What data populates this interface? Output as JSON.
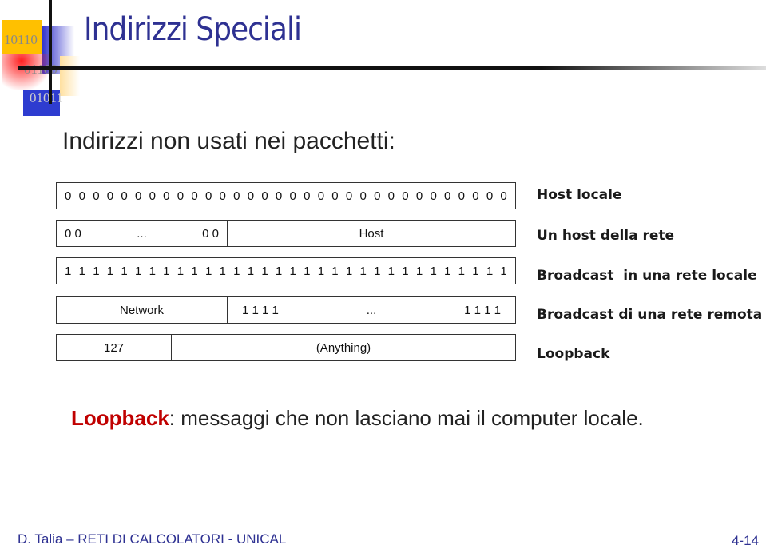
{
  "header": {
    "title": "Indirizzi Speciali",
    "logo_text": [
      "10110",
      "01100",
      "01011"
    ]
  },
  "subtitle": "Indirizzi non usati nei pacchetti:",
  "rows": [
    {
      "bits": "00000000000000000000000000000000",
      "label": "Host locale"
    },
    {
      "left": [
        "0 0",
        "...",
        "0 0"
      ],
      "right": "Host",
      "label": "Un host della rete"
    },
    {
      "bits": "11111111111111111111111111111111",
      "label": "Broadcast  in una rete locale"
    },
    {
      "left": "Network",
      "right": [
        "1 1 1 1",
        "...",
        "1 1 1 1"
      ],
      "label": "Broadcast di una rete remota"
    },
    {
      "left": "127",
      "right": "(Anything)",
      "label": "Loopback"
    }
  ],
  "note": {
    "keyword": "Loopback",
    "text": ": messaggi che non lasciano mai il computer locale."
  },
  "footer": {
    "text": "D. Talia – RETI DI CALCOLATORI - UNICAL",
    "page": "4-14"
  },
  "colors": {
    "title": "#2e3192",
    "keyword": "#c00000"
  }
}
